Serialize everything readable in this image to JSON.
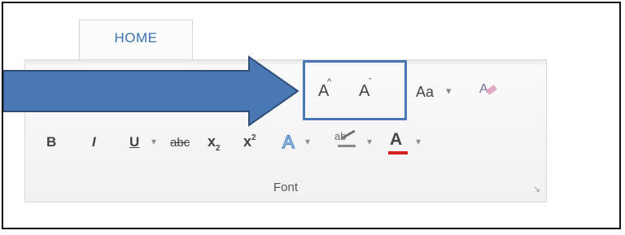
{
  "tab": {
    "label": "HOME"
  },
  "font_group": {
    "label": "Font",
    "row1": {
      "dropdown_chevron": "▾",
      "grow_font": "A",
      "grow_sup": "^",
      "shrink_font": "A",
      "shrink_sup": "ˇ",
      "change_case": "Aa",
      "change_case_chevron": "▾",
      "clear_formatting": "A"
    },
    "row2": {
      "bold": "B",
      "italic": "I",
      "underline": "U",
      "underline_chevron": "▾",
      "strikethrough": "abc",
      "subscript_base": "x",
      "subscript_mark": "2",
      "superscript_base": "x",
      "superscript_mark": "2",
      "text_effects": "A",
      "text_effects_chevron": "▾",
      "highlight": "ab",
      "highlight_chevron": "▾",
      "font_color": "A",
      "font_color_chevron": "▾"
    },
    "launcher": "↘"
  },
  "colors": {
    "arrow_fill": "#4a78b5",
    "arrow_stroke": "#2f4f79",
    "highlight_box": "#4a78b5",
    "font_color_bar": "#d21f1f"
  }
}
